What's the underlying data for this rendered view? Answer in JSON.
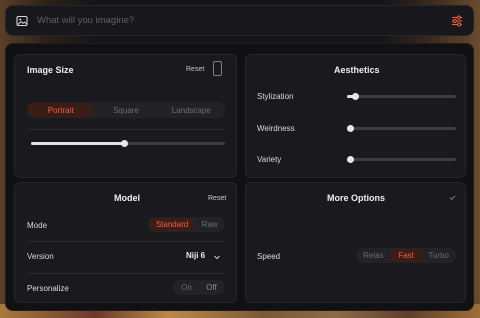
{
  "search": {
    "placeholder": "What will you imagine?"
  },
  "image_size": {
    "title": "Image Size",
    "reset_label": "Reset",
    "orientation_options": [
      "Portrait",
      "Square",
      "Landscape"
    ],
    "selected_orientation": "Portrait",
    "size_slider_value": 0.48
  },
  "aesthetics": {
    "title": "Aesthetics",
    "sliders": [
      {
        "label": "Stylization",
        "value": 0.08
      },
      {
        "label": "Weirdness",
        "value": 0.0
      },
      {
        "label": "Variety",
        "value": 0.0
      }
    ]
  },
  "model": {
    "title": "Model",
    "reset_label": "Reset",
    "mode_label": "Mode",
    "mode_options": [
      "Standard",
      "Raw"
    ],
    "selected_mode": "Standard",
    "version_label": "Version",
    "version_value": "Niji 6",
    "personalize_label": "Personalize",
    "personalize_options": [
      "On",
      "Off"
    ],
    "selected_personalize": "Off"
  },
  "more_options": {
    "title": "More Options",
    "speed_label": "Speed",
    "speed_options": [
      "Relax",
      "Fast",
      "Turbo"
    ],
    "selected_speed": "Fast"
  },
  "colors": {
    "accent": "#f0613e",
    "accent_bg": "#3a1d17",
    "panel": "#111114",
    "card": "#1a1a1e"
  },
  "icons": {
    "search_bar_left": "image-icon",
    "search_bar_right": "sliders-tune-icon",
    "version_dropdown": "chevron-down-icon",
    "more_options_toggle": "checkmark-icon",
    "aspect_ratio": "portrait-ratio-icon"
  }
}
